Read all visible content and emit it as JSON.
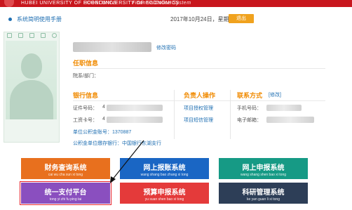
{
  "header": {
    "left_text": "HUBEI UNIVERSITY OF ECONOMICS",
    "mid_text": "HUBEI UNIVERSITY OF ECONOMICS",
    "right_text": "FinancialOnline System"
  },
  "topbar": {
    "manual_link": "系统简明使用手册",
    "date": "2017年10月24日，星期二",
    "logout": "退出"
  },
  "profile": {
    "change_password": "修改密码",
    "job": {
      "title": "任职信息",
      "dept_label": "院系/部门："
    },
    "bank": {
      "title": "银行信息",
      "id_label": "证件号码：",
      "id_prefix": "4",
      "staff_label": "工资卡号：",
      "staff_prefix": "4",
      "fund_account": "单位公积金账号：1370887",
      "fund_bank": "公积金单位缴存银行：中国银行东湖支行"
    },
    "owner": {
      "title": "负责人操作",
      "link1": "项目授权管理",
      "link2": "项目短信管理"
    },
    "contact": {
      "title": "联系方式",
      "modify": "[修改]",
      "phone_label": "手机号码：",
      "email_label": "电子邮箱："
    }
  },
  "tiles": [
    {
      "title": "财务查询系统",
      "pinyin": "cai wu cha xun xi tong",
      "color": "#e8701e"
    },
    {
      "title": "网上报账系统",
      "pinyin": "wang shang bao zhang xi tong",
      "color": "#1a66c4"
    },
    {
      "title": "网上申报系统",
      "pinyin": "wang shang shen bao xi tong",
      "color": "#169a85"
    },
    {
      "title": "统一支付平台",
      "pinyin": "tong yi zhi fu ping tai",
      "color": "#8a4fbf"
    },
    {
      "title": "预算申报系统",
      "pinyin": "yu suan shen bao xi tong",
      "color": "#e43a3a"
    },
    {
      "title": "科研管理系统",
      "pinyin": "ke yan guan li xi tong",
      "color": "#2d3e57"
    }
  ],
  "colors": {
    "header": "#c8161d",
    "accent": "#f08a00",
    "link": "#1f6fb2"
  }
}
